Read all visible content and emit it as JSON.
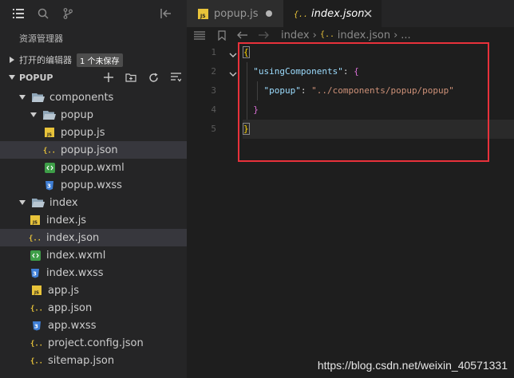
{
  "sidebar": {
    "title": "资源管理器",
    "open_editors": {
      "label": "打开的编辑器",
      "badge": "1 个未保存"
    },
    "project": {
      "label": "POPUP"
    },
    "tree": [
      {
        "label": "components",
        "depth": 1,
        "kind": "folder-open",
        "selected": false
      },
      {
        "label": "popup",
        "depth": 2,
        "kind": "folder-open",
        "selected": false
      },
      {
        "label": "popup.js",
        "depth": 3,
        "kind": "js",
        "selected": false
      },
      {
        "label": "popup.json",
        "depth": 3,
        "kind": "json",
        "selected": true
      },
      {
        "label": "popup.wxml",
        "depth": 3,
        "kind": "wxml",
        "selected": false
      },
      {
        "label": "popup.wxss",
        "depth": 3,
        "kind": "wxss",
        "selected": false
      },
      {
        "label": "index",
        "depth": 1,
        "kind": "folder-open",
        "selected": false
      },
      {
        "label": "index.js",
        "depth": 2,
        "kind": "js",
        "selected": false
      },
      {
        "label": "index.json",
        "depth": 2,
        "kind": "json",
        "selected": true
      },
      {
        "label": "index.wxml",
        "depth": 2,
        "kind": "wxml",
        "selected": false
      },
      {
        "label": "index.wxss",
        "depth": 2,
        "kind": "wxss",
        "selected": false
      },
      {
        "label": "app.js",
        "depth": 0,
        "kind": "js",
        "selected": false
      },
      {
        "label": "app.json",
        "depth": 0,
        "kind": "json",
        "selected": false
      },
      {
        "label": "app.wxss",
        "depth": 0,
        "kind": "wxss",
        "selected": false
      },
      {
        "label": "project.config.json",
        "depth": 0,
        "kind": "json",
        "selected": false
      },
      {
        "label": "sitemap.json",
        "depth": 0,
        "kind": "json",
        "selected": false
      }
    ]
  },
  "tabs": [
    {
      "label": "popup.js",
      "icon": "js-file-icon",
      "active": false,
      "dirty": true
    },
    {
      "label": "index.json",
      "icon": "json-file-icon",
      "active": true,
      "dirty": false
    }
  ],
  "breadcrumb": {
    "folder": "index",
    "file": "index.json",
    "more": "..."
  },
  "editor": {
    "line_numbers": [
      "1",
      "2",
      "3",
      "4",
      "5"
    ],
    "tokens": {
      "open_brace": "{",
      "key_using": "\"usingComponents\"",
      "colon": ":",
      "inner_open": "{",
      "key_popup": "\"popup\"",
      "value_popup": "\"../components/popup/popup\"",
      "inner_close": "}",
      "close_brace": "}"
    }
  },
  "watermark": "https://blog.csdn.net/weixin_40571331",
  "colors": {
    "highlight_box": "#e8313b",
    "js_icon": "#e8c33a",
    "wxml_icon": "#3e9e48",
    "wxss_icon": "#3f7fd6",
    "folder_icon": "#8fa6b8"
  }
}
